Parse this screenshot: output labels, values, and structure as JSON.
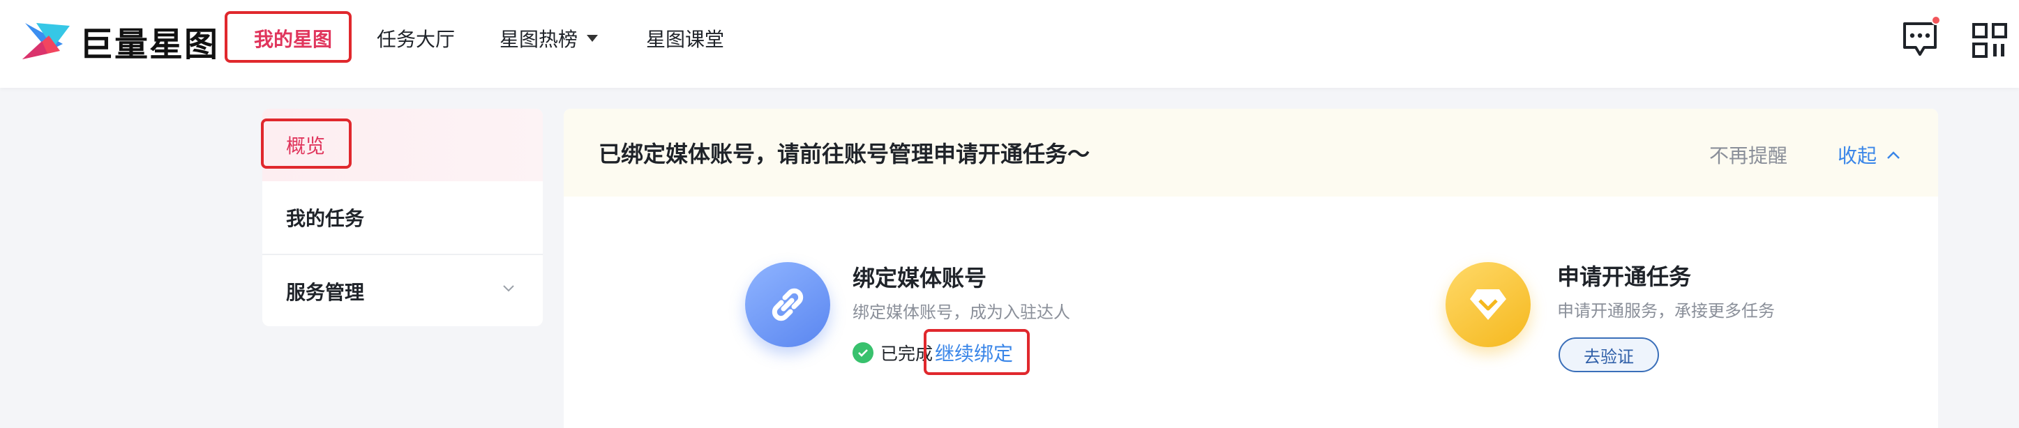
{
  "header": {
    "logo_text": "巨量星图",
    "nav": [
      {
        "label": "我的星图",
        "active": true
      },
      {
        "label": "任务大厅"
      },
      {
        "label": "星图热榜",
        "has_dropdown": true
      },
      {
        "label": "星图课堂"
      }
    ],
    "icons": [
      "message-icon",
      "qr-code-icon"
    ],
    "has_notification": true
  },
  "sidebar": {
    "items": [
      {
        "label": "概览",
        "active": true
      },
      {
        "label": "我的任务"
      },
      {
        "label": "服务管理",
        "expandable": true
      }
    ]
  },
  "banner": {
    "text": "已绑定媒体账号，请前往账号管理申请开通任务～",
    "dismiss_label": "不再提醒",
    "collapse_label": "收起"
  },
  "steps": [
    {
      "icon": "link-icon",
      "title": "绑定媒体账号",
      "desc": "绑定媒体账号，成为入驻达人",
      "status_label": "已完成",
      "action_label": "继续绑定"
    },
    {
      "icon": "diamond-icon",
      "title": "申请开通任务",
      "desc": "申请开通服务，承接更多任务",
      "action_label": "去验证"
    }
  ],
  "colors": {
    "brand_pink": "#e0355c",
    "link_blue": "#3a86e8",
    "highlight_red": "#e0282d",
    "banner_bg": "#fdfbf1",
    "success_green": "#38c16d"
  }
}
